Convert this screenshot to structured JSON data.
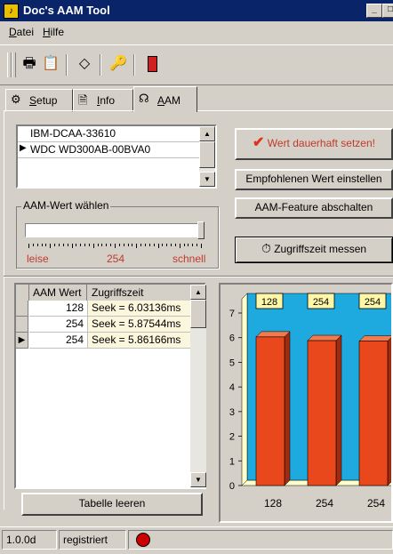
{
  "window": {
    "title": "Doc's AAM Tool",
    "min_glyph": "_",
    "max_glyph": "□"
  },
  "menu": [
    "Datei",
    "Hilfe"
  ],
  "toolbar": {
    "icons": [
      "print-icon",
      "print-preview-icon",
      "eraser-icon",
      "key-icon",
      "exit-door-icon"
    ]
  },
  "tabs": [
    {
      "label": "Setup",
      "icon": "setup-icon"
    },
    {
      "label": "Info",
      "icon": "info-icon"
    },
    {
      "label": "AAM",
      "icon": "aam-icon",
      "active": true
    }
  ],
  "drives": {
    "items": [
      "IBM-DCAA-33610",
      "WDC WD300AB-00BVA0"
    ],
    "selected_index": 1
  },
  "aam_group": {
    "title": "AAM-Wert wählen",
    "left_label": "leise",
    "value_label": "254",
    "right_label": "schnell",
    "slider_fraction": 1.0
  },
  "buttons": {
    "set_permanent": "Wert dauerhaft setzen!",
    "recommended": "Empfohlenen Wert einstellen",
    "disable": "AAM-Feature abschalten",
    "measure": "Zugriffszeit messen",
    "clear_table": "Tabelle leeren"
  },
  "table": {
    "columns": [
      "AAM Wert",
      "Zugriffszeit"
    ],
    "rows": [
      {
        "aam": "128",
        "time": "Seek = 6.03136ms"
      },
      {
        "aam": "254",
        "time": "Seek = 5.87544ms"
      },
      {
        "aam": "254",
        "time": "Seek = 5.86166ms"
      }
    ],
    "current_row_index": 2
  },
  "chart_data": {
    "type": "bar",
    "categories": [
      "128",
      "254",
      "254"
    ],
    "values": [
      6.03,
      5.88,
      5.86
    ],
    "data_labels": [
      "128",
      "254",
      "254"
    ],
    "yticks": [
      "0",
      "1",
      "2",
      "3",
      "4",
      "5",
      "6",
      "7"
    ],
    "ylim": [
      0,
      7.5
    ],
    "grid": false,
    "colors": {
      "background": "#1eaadf",
      "bar": "#e8481c",
      "label_box": "#fff7a8"
    }
  },
  "status": {
    "version": "1.0.0d",
    "registration": "registriert",
    "indicator_color": "#cc0000"
  }
}
